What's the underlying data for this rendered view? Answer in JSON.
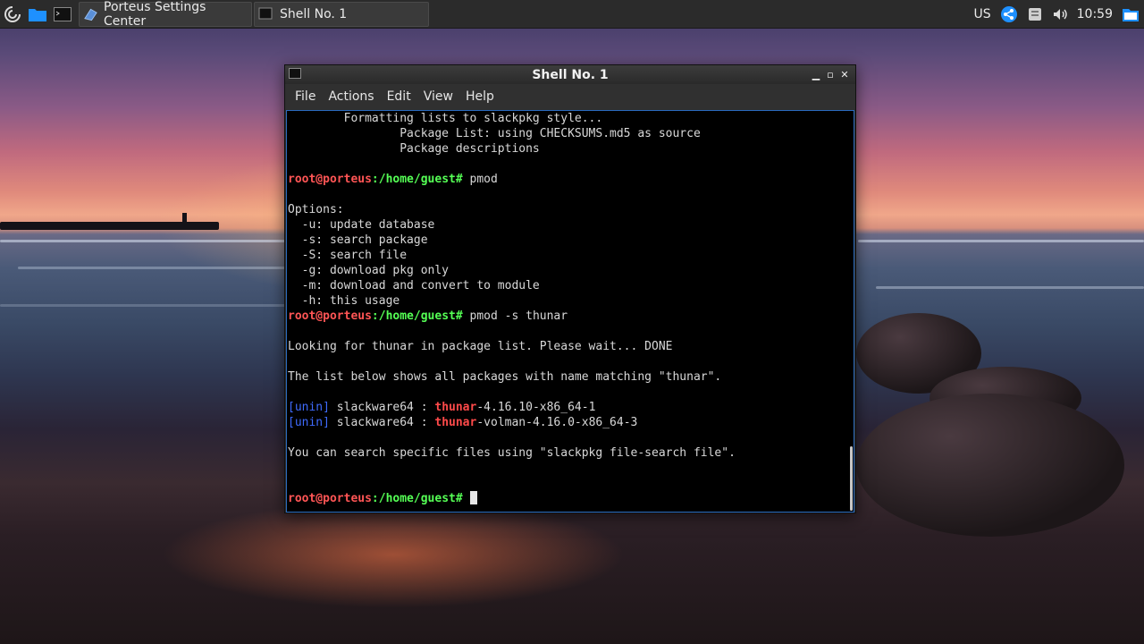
{
  "taskbar": {
    "tasks": [
      {
        "label": "Porteus Settings Center"
      },
      {
        "label": "Shell No. 1"
      }
    ],
    "tray": {
      "keyboard_layout": "US",
      "clock": "10:59"
    }
  },
  "window": {
    "title": "Shell No. 1",
    "menu": [
      "File",
      "Actions",
      "Edit",
      "View",
      "Help"
    ]
  },
  "terminal": {
    "prompt_user": "root@porteus",
    "prompt_path": ":/home/guest#",
    "lines": {
      "l1": "        Formatting lists to slackpkg style...",
      "l2": "                Package List: using CHECKSUMS.md5 as source",
      "l3": "                Package descriptions",
      "cmd1": " pmod",
      "opt_header": "Options:",
      "opt_u": "  -u: update database",
      "opt_s": "  -s: search package",
      "opt_S": "  -S: search file",
      "opt_g": "  -g: download pkg only",
      "opt_m": "  -m: download and convert to module",
      "opt_h": "  -h: this usage",
      "cmd2": " pmod -s thunar",
      "looking": "Looking for thunar in package list. Please wait... DONE",
      "listinfo": "The list below shows all packages with name matching \"thunar\".",
      "tip": "You can search specific files using \"slackpkg file-search file\"."
    },
    "results": [
      {
        "status": "unin",
        "repo": " slackware64 : ",
        "name": "thunar",
        "version": "-4.16.10-x86_64-1"
      },
      {
        "status": "unin",
        "repo": " slackware64 : ",
        "name": "thunar",
        "version": "-volman-4.16.0-x86_64-3"
      }
    ]
  }
}
